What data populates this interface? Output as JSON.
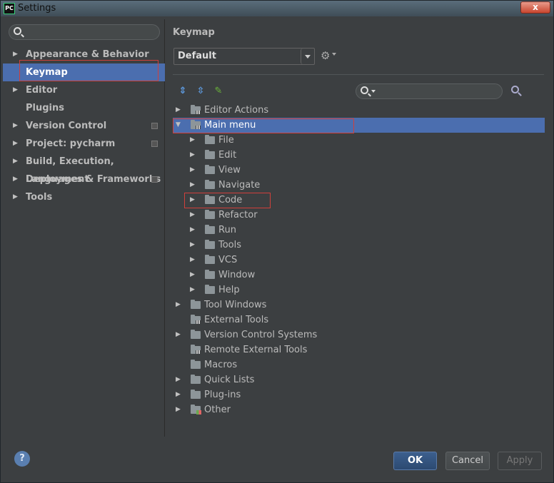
{
  "window": {
    "title": "Settings",
    "app_icon": "PC",
    "close": "x"
  },
  "left": {
    "search": {
      "placeholder": ""
    },
    "nav": [
      {
        "label": "Appearance & Behavior",
        "expandable": true,
        "selected": false,
        "project_icon": false
      },
      {
        "label": "Keymap",
        "expandable": false,
        "selected": true,
        "project_icon": false
      },
      {
        "label": "Editor",
        "expandable": true,
        "selected": false,
        "project_icon": false
      },
      {
        "label": "Plugins",
        "expandable": false,
        "selected": false,
        "project_icon": false
      },
      {
        "label": "Version Control",
        "expandable": true,
        "selected": false,
        "project_icon": true
      },
      {
        "label": "Project: pycharm",
        "expandable": true,
        "selected": false,
        "project_icon": true
      },
      {
        "label": "Build, Execution, Deployment",
        "expandable": true,
        "selected": false,
        "project_icon": false
      },
      {
        "label": "Languages & Frameworks",
        "expandable": true,
        "selected": false,
        "project_icon": true
      },
      {
        "label": "Tools",
        "expandable": true,
        "selected": false,
        "project_icon": false
      }
    ]
  },
  "right": {
    "title": "Keymap",
    "keymap_select": {
      "value": "Default"
    },
    "search": {
      "placeholder": ""
    },
    "tree": [
      {
        "label": "Editor Actions",
        "level": 0,
        "arrow": "collapsed",
        "icon": "grid",
        "selected": false
      },
      {
        "label": "Main menu",
        "level": 0,
        "arrow": "expanded",
        "icon": "grid",
        "selected": true
      },
      {
        "label": "File",
        "level": 1,
        "arrow": "collapsed",
        "icon": "folder",
        "selected": false
      },
      {
        "label": "Edit",
        "level": 1,
        "arrow": "collapsed",
        "icon": "folder",
        "selected": false
      },
      {
        "label": "View",
        "level": 1,
        "arrow": "collapsed",
        "icon": "folder",
        "selected": false
      },
      {
        "label": "Navigate",
        "level": 1,
        "arrow": "collapsed",
        "icon": "folder",
        "selected": false
      },
      {
        "label": "Code",
        "level": 1,
        "arrow": "collapsed",
        "icon": "folder",
        "selected": false
      },
      {
        "label": "Refactor",
        "level": 1,
        "arrow": "collapsed",
        "icon": "folder",
        "selected": false
      },
      {
        "label": "Run",
        "level": 1,
        "arrow": "collapsed",
        "icon": "folder",
        "selected": false
      },
      {
        "label": "Tools",
        "level": 1,
        "arrow": "collapsed",
        "icon": "folder",
        "selected": false
      },
      {
        "label": "VCS",
        "level": 1,
        "arrow": "collapsed",
        "icon": "folder",
        "selected": false
      },
      {
        "label": "Window",
        "level": 1,
        "arrow": "collapsed",
        "icon": "folder",
        "selected": false
      },
      {
        "label": "Help",
        "level": 1,
        "arrow": "collapsed",
        "icon": "folder",
        "selected": false
      },
      {
        "label": "Tool Windows",
        "level": 0,
        "arrow": "collapsed",
        "icon": "folder",
        "selected": false
      },
      {
        "label": "External Tools",
        "level": 0,
        "arrow": "none",
        "icon": "grid",
        "selected": false
      },
      {
        "label": "Version Control Systems",
        "level": 0,
        "arrow": "collapsed",
        "icon": "folder",
        "selected": false
      },
      {
        "label": "Remote External Tools",
        "level": 0,
        "arrow": "none",
        "icon": "grid",
        "selected": false
      },
      {
        "label": "Macros",
        "level": 0,
        "arrow": "none",
        "icon": "folder",
        "selected": false
      },
      {
        "label": "Quick Lists",
        "level": 0,
        "arrow": "collapsed",
        "icon": "folder",
        "selected": false
      },
      {
        "label": "Plug-ins",
        "level": 0,
        "arrow": "collapsed",
        "icon": "folder",
        "selected": false
      },
      {
        "label": "Other",
        "level": 0,
        "arrow": "collapsed",
        "icon": "other",
        "selected": false
      }
    ]
  },
  "buttons": {
    "help": "?",
    "ok": "OK",
    "cancel": "Cancel",
    "apply": "Apply"
  },
  "colors": {
    "selection": "#4b6eaf",
    "highlight_box": "#d0403b",
    "background": "#3c3f41"
  }
}
